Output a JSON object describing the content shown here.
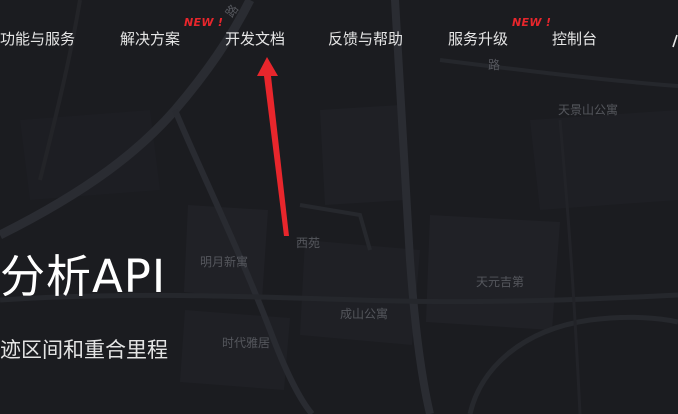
{
  "nav": {
    "items": [
      {
        "label": "功能与服务",
        "new": false
      },
      {
        "label": "解决方案",
        "new": true
      },
      {
        "label": "开发文档",
        "new": false
      },
      {
        "label": "反馈与帮助",
        "new": false
      },
      {
        "label": "服务升级",
        "new": true
      },
      {
        "label": "控制台",
        "new": false
      }
    ],
    "new_badge": "NEW !"
  },
  "hero": {
    "title": "分析API",
    "subtitle": "迹区间和重合里程"
  },
  "map_labels": [
    "天景山公寓",
    "西苑",
    "明月新寓",
    "天元吉第",
    "成山公寓",
    "时代雅居",
    "路",
    "路"
  ],
  "colors": {
    "background": "#1b1c20",
    "nav_text": "#e6e6e6",
    "badge": "#e8262c",
    "arrow": "#e8262c",
    "map_label": "#55575d"
  }
}
